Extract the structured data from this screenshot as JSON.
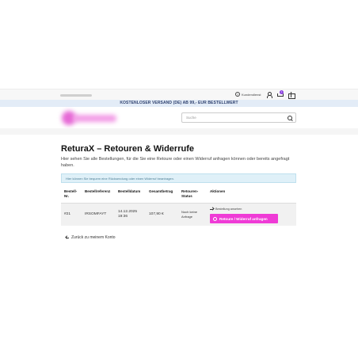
{
  "topbar": {
    "help_label": "Kundendienst",
    "cart_count": "1"
  },
  "shipping_banner": "KOSTENLOSER VERSAND (DE) AB 99,- EUR BESTELLWERT",
  "search": {
    "placeholder": "Suche"
  },
  "page": {
    "title": "ReturaX – Retouren & Widerrufe",
    "intro": "Hier sehen Sie alle Bestellungen, für die Sie eine Retoure oder einen Widerruf anfragen können oder bereits angefragt haben.",
    "info_notice": "Hier können Sie bequem eine Rücksendung oder einen Widerruf beantragen."
  },
  "table": {
    "headers": [
      "Bestell-Nr.",
      "Bestellreferenz",
      "Bestelldatum",
      "Gesamtbetrag",
      "Retouren-Status",
      "Aktionen"
    ],
    "rows": [
      {
        "nr": "#21",
        "reference": "IRSOMFAYT",
        "date": "14.12.2025 19:36",
        "total": "107,90 €",
        "status": "Noch keine Anfrage",
        "view_order": "Bestellung ansehen",
        "return_button": "Retoure / Widerruf anfragen"
      }
    ]
  },
  "back_link": "Zurück zu meinem Konto",
  "colors": {
    "accent": "#ef3bd6",
    "shipping_bar": "#e3ecf7",
    "info_bg": "#dff0f8"
  }
}
